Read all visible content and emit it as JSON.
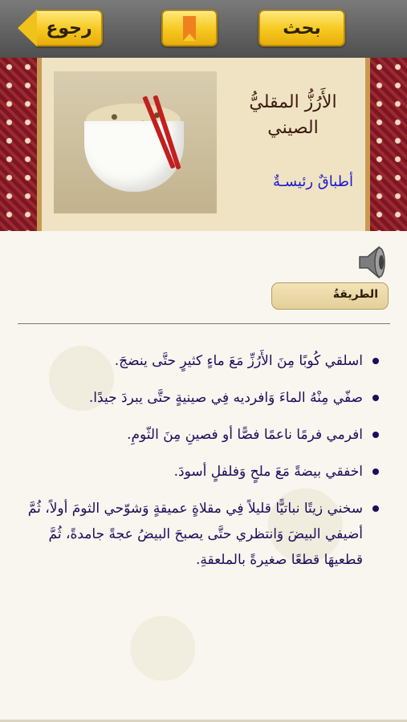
{
  "toolbar": {
    "back_label": "رجوع",
    "bookmark_icon": "bookmark-icon",
    "search_label": "بحث"
  },
  "recipe": {
    "title": "الأَرُزُّ المقليُّ الصيني",
    "category": "أطباقٌ رئيسـةٌ",
    "image_icon": "fried-rice-photo"
  },
  "section": {
    "label": "الطريقةُ",
    "audio_icon": "speaker-icon"
  },
  "steps": [
    "اسلقي كُوبًا مِنَ الأَرُزِّ مَعَ ماءٍ كثيرٍ حتَّى ينضجَ.",
    "صفّي مِنْهُ الماءَ وَافرديه فِي صينيةٍ حتَّى يبردَ جيدًا.",
    "افرمي فرمًا ناعمًا فصًّا أو فصينِ مِنَ الثّومِ.",
    "اخفقي بيضةً مَعَ ملحٍ وَفلفلٍ أسودَ.",
    "سخني زيتًا نباتيًّا قليلاً فِي مقلاةٍ عميقةٍ وَشوّحي الثومَ أولاً، ثُمَّ أضيفي البيضَ وَانتظري حتَّى يصبحَ البيضُ عجةً جامدةً، ثُمَّ قطعيهَا قطعًا صغيرةً بالملعقةِ."
  ],
  "colors": {
    "toolbar_bg": "#5f5f5f",
    "button_yellow": "#f6c81f",
    "pattern_red": "#8b1f2a",
    "title_brown": "#3b1a0e",
    "category_blue": "#1a1ad0",
    "step_text": "#1e0c5a"
  }
}
